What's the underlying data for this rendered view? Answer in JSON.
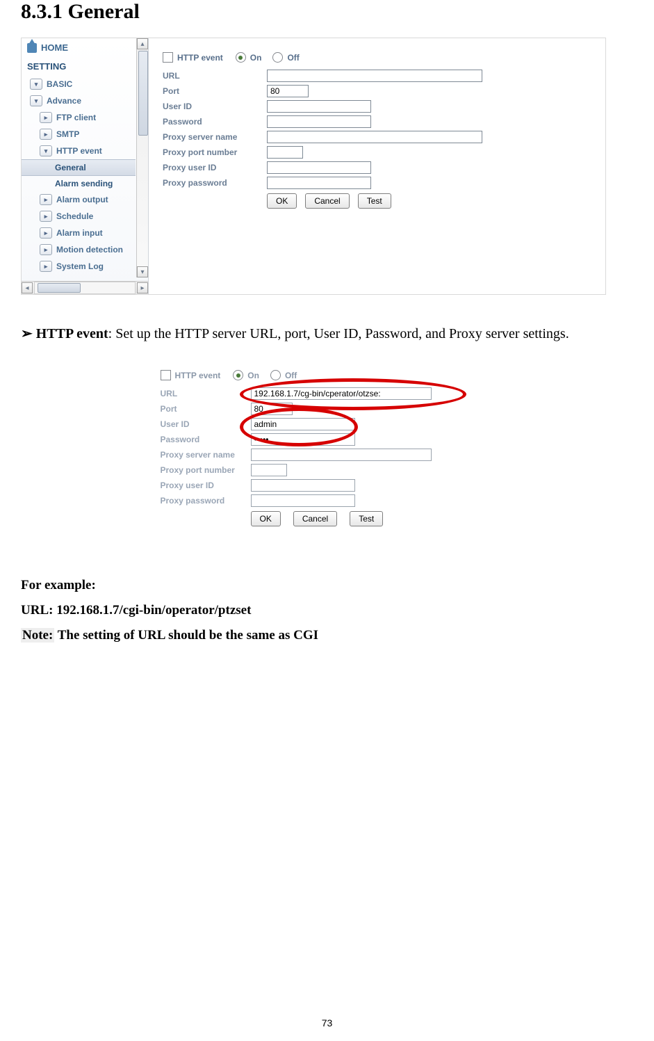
{
  "heading": "8.3.1 General",
  "sidebar": {
    "home": "HOME",
    "setting": "SETTING",
    "items": [
      {
        "label": "BASIC",
        "kind": "toggle-down"
      },
      {
        "label": "Advance",
        "kind": "toggle-down"
      },
      {
        "label": "FTP client",
        "kind": "toggle-right"
      },
      {
        "label": "SMTP",
        "kind": "toggle-right"
      },
      {
        "label": "HTTP event",
        "kind": "toggle-down"
      },
      {
        "label": "General",
        "kind": "leaf-selected"
      },
      {
        "label": "Alarm sending",
        "kind": "leaf"
      },
      {
        "label": "Alarm output",
        "kind": "toggle-right"
      },
      {
        "label": "Schedule",
        "kind": "toggle-right"
      },
      {
        "label": "Alarm input",
        "kind": "toggle-right"
      },
      {
        "label": "Motion detection",
        "kind": "toggle-right"
      },
      {
        "label": "System Log",
        "kind": "toggle-right"
      }
    ]
  },
  "form1": {
    "title": "HTTP event",
    "on": "On",
    "off": "Off",
    "fields": {
      "url": "URL",
      "port": "Port",
      "user": "User ID",
      "pass": "Password",
      "pserver": "Proxy server name",
      "pport": "Proxy port number",
      "puser": "Proxy user ID",
      "ppass": "Proxy password"
    },
    "values": {
      "url": "",
      "port": "80",
      "user": "",
      "pass": "",
      "pserver": "",
      "pport": "",
      "puser": "",
      "ppass": ""
    },
    "buttons": {
      "ok": "OK",
      "cancel": "Cancel",
      "test": "Test"
    }
  },
  "paragraph": {
    "bullet": "➢",
    "bold": "HTTP event",
    "rest": ": Set up the HTTP server URL, port, User ID, Password, and Proxy server settings."
  },
  "form2": {
    "title": "HTTP event",
    "on": "On",
    "off": "Off",
    "fields": {
      "url": "URL",
      "port": "Port",
      "user": "User ID",
      "pass": "Password",
      "pserver": "Proxy server name",
      "pport": "Proxy port number",
      "puser": "Proxy user ID",
      "ppass": "Proxy password"
    },
    "values": {
      "url": "192.168.1.7/cg-bin/cperator/otzse:",
      "port": "80",
      "user": "admin",
      "pass": "•••••",
      "pserver": "",
      "pport": "",
      "puser": "",
      "ppass": ""
    },
    "buttons": {
      "ok": "OK",
      "cancel": "Cancel",
      "test": "Test"
    }
  },
  "example": {
    "line1": "For example:",
    "line2": "URL: 192.168.1.7/cgi-bin/operator/ptzset",
    "noteLabel": "Note:",
    "noteRest": " The setting of URL should be the same as CGI"
  },
  "pagenum": "73"
}
